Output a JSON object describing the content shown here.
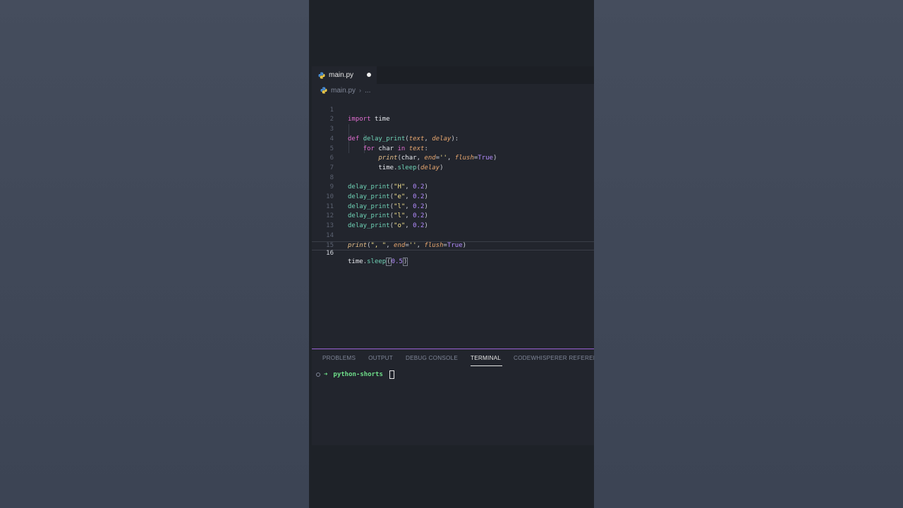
{
  "editor": {
    "tab_label": "main.py",
    "breadcrumb": {
      "file": "main.py",
      "ellipsis": "..."
    }
  },
  "code": {
    "line_numbers": [
      "1",
      "2",
      "3",
      "4",
      "5",
      "6",
      "7",
      "8",
      "9",
      "10",
      "11",
      "12",
      "13",
      "14",
      "15",
      "16"
    ],
    "delay_call_args": [
      "\"H\"",
      "\"e\"",
      "\"l\"",
      "\"l\"",
      "\"o\""
    ],
    "delay_value": "0.2"
  },
  "panel": {
    "tabs": [
      "PROBLEMS",
      "OUTPUT",
      "DEBUG CONSOLE",
      "TERMINAL",
      "CODEWHISPERER REFERENCE"
    ],
    "active_tab": "TERMINAL",
    "prompt_dir": "python-shorts"
  },
  "colors": {
    "accent": "#9a62d6",
    "keyword": "#e26ed1",
    "function": "#6fd3b6",
    "string": "#f2e08e",
    "number": "#b48cff",
    "terminal_prompt": "#6fe08a"
  }
}
